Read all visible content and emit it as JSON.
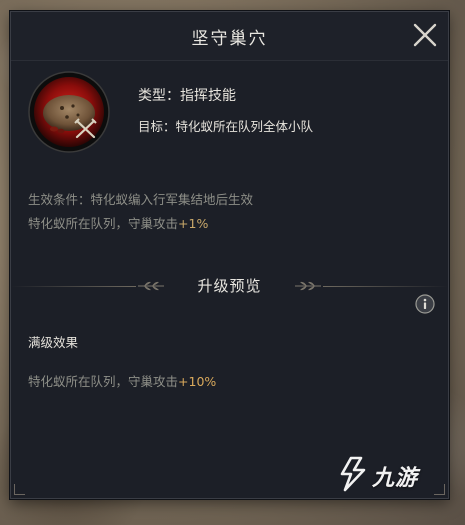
{
  "dialog": {
    "title": "坚守巢穴",
    "close_icon": "close-icon"
  },
  "skill": {
    "icon": "nest-defense-skill-icon",
    "type": "类型：指挥技能",
    "target": "目标：特化蚁所在队列全体小队"
  },
  "current_effect": {
    "condition": "生效条件：特化蚁编入行军集结地后生效",
    "desc_prefix": "特化蚁所在队列，守巢攻击",
    "desc_value": "+1%"
  },
  "upgrade_preview": {
    "title": "升级预览",
    "info_icon": "info-icon",
    "max_level_label": "满级效果",
    "max_desc_prefix": "特化蚁所在队列，守巢攻击",
    "max_desc_value": "+10%"
  },
  "watermark": {
    "logo": "jiuyou-logo",
    "text": "九游"
  },
  "colors": {
    "panel_bg": "#1c1f27",
    "text_primary": "#e6e3dc",
    "text_secondary": "#8e8f88",
    "accent_gold": "#d9a95c"
  }
}
